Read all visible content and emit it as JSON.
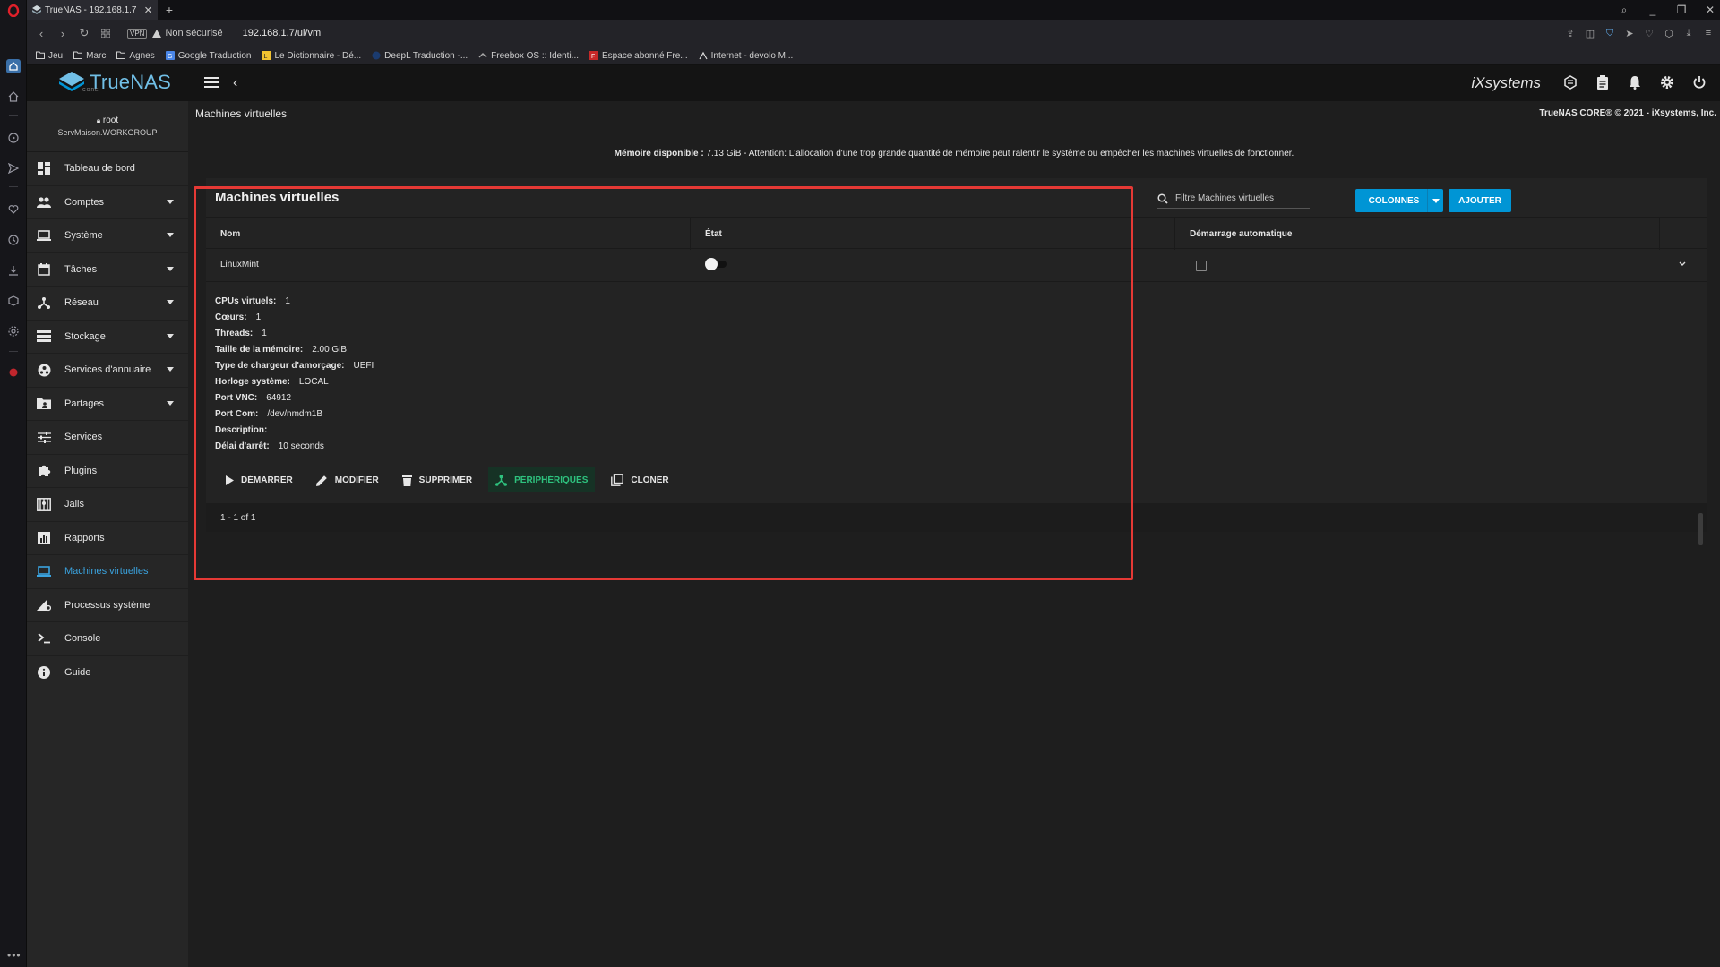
{
  "browser": {
    "tab_title": "TrueNAS - 192.168.1.7",
    "security_label": "Non sécurisé",
    "vpn_label": "VPN",
    "url": "192.168.1.7/ui/vm",
    "bookmarks": [
      {
        "label": "Jeu",
        "icon": "folder-icon"
      },
      {
        "label": "Marc",
        "icon": "folder-icon"
      },
      {
        "label": "Agnes",
        "icon": "folder-icon"
      },
      {
        "label": "Google Traduction",
        "icon": "google-translate-icon"
      },
      {
        "label": "Le Dictionnaire - Dé...",
        "icon": "dictionary-icon"
      },
      {
        "label": "DeepL Traduction -...",
        "icon": "deepl-icon"
      },
      {
        "label": "Freebox OS :: Identi...",
        "icon": "freebox-icon"
      },
      {
        "label": "Espace abonné Fre...",
        "icon": "free-icon"
      },
      {
        "label": "Internet - devolo M...",
        "icon": "devolo-icon"
      }
    ]
  },
  "app": {
    "logo_text": "TrueNAS",
    "logo_sub": "CORE",
    "vendor_logo": "iXsystems",
    "header_icons": [
      "truecommand-icon",
      "clipboard-icon",
      "bell-icon",
      "gear-icon",
      "power-icon"
    ]
  },
  "sidebar": {
    "user": "root",
    "host": "ServMaison.WORKGROUP",
    "items": [
      {
        "label": "Tableau de bord",
        "icon": "dashboard-icon",
        "arrow": false
      },
      {
        "label": "Comptes",
        "icon": "people-icon",
        "arrow": true
      },
      {
        "label": "Système",
        "icon": "laptop-icon",
        "arrow": true
      },
      {
        "label": "Tâches",
        "icon": "calendar-icon",
        "arrow": true
      },
      {
        "label": "Réseau",
        "icon": "network-icon",
        "arrow": true
      },
      {
        "label": "Stockage",
        "icon": "storage-icon",
        "arrow": true
      },
      {
        "label": "Services d'annuaire",
        "icon": "directory-icon",
        "arrow": true
      },
      {
        "label": "Partages",
        "icon": "folder-share-icon",
        "arrow": true
      },
      {
        "label": "Services",
        "icon": "sliders-icon",
        "arrow": false
      },
      {
        "label": "Plugins",
        "icon": "puzzle-icon",
        "arrow": false
      },
      {
        "label": "Jails",
        "icon": "jail-icon",
        "arrow": false
      },
      {
        "label": "Rapports",
        "icon": "chart-icon",
        "arrow": false
      },
      {
        "label": "Machines virtuelles",
        "icon": "computer-icon",
        "arrow": false,
        "active": true
      },
      {
        "label": "Processus système",
        "icon": "process-icon",
        "arrow": false
      },
      {
        "label": "Console",
        "icon": "terminal-icon",
        "arrow": false
      },
      {
        "label": "Guide",
        "icon": "info-icon",
        "arrow": false
      }
    ]
  },
  "main": {
    "page_title": "Machines virtuelles",
    "copyright": "TrueNAS CORE® © 2021 - iXsystems, Inc.",
    "memory_label": "Mémoire disponible :",
    "memory_text": "7.13 GiB - Attention: L'allocation d'une trop grande quantité de mémoire peut ralentir le système ou empêcher les machines virtuelles de fonctionner.",
    "card": {
      "title": "Machines virtuelles",
      "filter_placeholder": "Filtre Machines virtuelles",
      "columns_button": "COLONNES",
      "add_button": "AJOUTER",
      "headers": [
        "Nom",
        "État",
        "Démarrage automatique"
      ],
      "row": {
        "name": "LinuxMint",
        "state_on": false,
        "autostart": false
      },
      "details": [
        {
          "key": "CPUs virtuels:",
          "value": "1"
        },
        {
          "key": "Cœurs:",
          "value": "1"
        },
        {
          "key": "Threads:",
          "value": "1"
        },
        {
          "key": "Taille de la mémoire:",
          "value": "2.00 GiB"
        },
        {
          "key": "Type de chargeur d'amorçage:",
          "value": "UEFI"
        },
        {
          "key": "Horloge système:",
          "value": "LOCAL"
        },
        {
          "key": "Port VNC:",
          "value": "64912"
        },
        {
          "key": "Port Com:",
          "value": "/dev/nmdm1B"
        },
        {
          "key": "Description:",
          "value": ""
        },
        {
          "key": "Délai d'arrêt:",
          "value": "10 seconds"
        }
      ],
      "actions": [
        {
          "label": "DÉMARRER",
          "icon": "play-icon"
        },
        {
          "label": "MODIFIER",
          "icon": "pencil-icon"
        },
        {
          "label": "SUPPRIMER",
          "icon": "trash-icon"
        },
        {
          "label": "PÉRIPHÉRIQUES",
          "icon": "devices-icon",
          "highlight": true
        },
        {
          "label": "CLONER",
          "icon": "clone-icon"
        }
      ],
      "pager": "1 - 1 of 1"
    }
  },
  "colors": {
    "accent": "#0095d5",
    "active_nav": "#3aa3df",
    "highlight_green": "#2ec27e",
    "annotation_red": "#e53935"
  }
}
